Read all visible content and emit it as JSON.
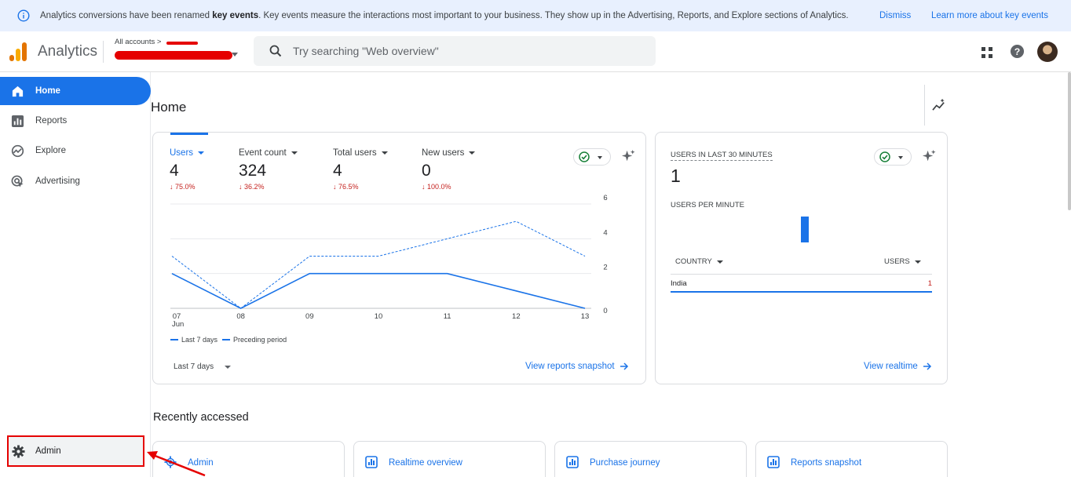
{
  "banner": {
    "text_before": "Analytics conversions have been renamed ",
    "text_bold": "key events",
    "text_after": ". Key events measure the interactions most important to your business. They show up in the Advertising, Reports, and Explore sections of Analytics.",
    "dismiss": "Dismiss",
    "learn_more": "Learn more about key events"
  },
  "header": {
    "app_name": "Analytics",
    "breadcrumb": "All accounts >",
    "search_placeholder": "Try searching \"Web overview\""
  },
  "sidebar": {
    "items": [
      {
        "label": "Home",
        "icon": "home-icon",
        "active": true
      },
      {
        "label": "Reports",
        "icon": "reports-icon"
      },
      {
        "label": "Explore",
        "icon": "explore-icon"
      },
      {
        "label": "Advertising",
        "icon": "advertising-icon"
      }
    ],
    "admin": "Admin"
  },
  "main": {
    "title": "Home",
    "metrics": [
      {
        "label": "Users",
        "value": "4",
        "change": "75.0%",
        "selected": true
      },
      {
        "label": "Event count",
        "value": "324",
        "change": "36.2%"
      },
      {
        "label": "Total users",
        "value": "4",
        "change": "76.5%"
      },
      {
        "label": "New users",
        "value": "0",
        "change": "100.0%"
      }
    ],
    "date_range": "Last 7 days",
    "view_reports": "View reports snapshot"
  },
  "chart_data": {
    "type": "line",
    "x": [
      "07",
      "08",
      "09",
      "10",
      "11",
      "12",
      "13"
    ],
    "x_sublabel": "Jun",
    "series": [
      {
        "name": "Last 7 days",
        "values": [
          2,
          0,
          2,
          2,
          2,
          1,
          0
        ],
        "style": "solid"
      },
      {
        "name": "Preceding period",
        "values": [
          3,
          0,
          3,
          3,
          4,
          5,
          3
        ],
        "style": "dashed"
      }
    ],
    "yticks": [
      0,
      2,
      4,
      6
    ],
    "ylim": [
      0,
      6
    ],
    "color": "#1a73e8"
  },
  "realtime": {
    "label": "USERS IN LAST 30 MINUTES",
    "value": "1",
    "per_minute": "USERS PER MINUTE",
    "col_country": "COUNTRY",
    "col_users": "USERS",
    "rows": [
      {
        "country": "India",
        "users": "1"
      }
    ],
    "view_realtime": "View realtime"
  },
  "recent": {
    "title": "Recently accessed",
    "items": [
      {
        "label": "Admin",
        "icon": "gear-icon"
      },
      {
        "label": "Realtime overview",
        "icon": "report-icon"
      },
      {
        "label": "Purchase journey",
        "icon": "report-icon"
      },
      {
        "label": "Reports snapshot",
        "icon": "report-icon"
      }
    ]
  },
  "colors": {
    "accent": "#1a73e8",
    "negative": "#c5221f",
    "annotation": "#e50000"
  }
}
